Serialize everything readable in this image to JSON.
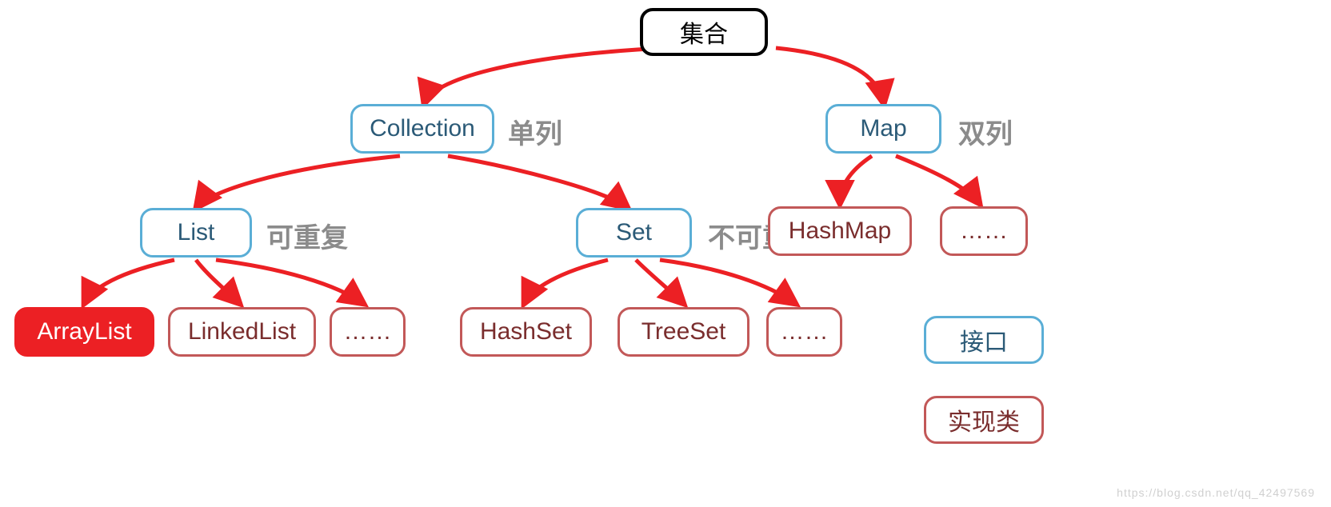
{
  "nodes": {
    "root": {
      "label": "集合"
    },
    "collection": {
      "label": "Collection"
    },
    "map": {
      "label": "Map"
    },
    "list": {
      "label": "List"
    },
    "set": {
      "label": "Set"
    },
    "arraylist": {
      "label": "ArrayList"
    },
    "linkedlist": {
      "label": "LinkedList"
    },
    "list_more": {
      "label": "……"
    },
    "hashset": {
      "label": "HashSet"
    },
    "treeset": {
      "label": "TreeSet"
    },
    "set_more": {
      "label": "……"
    },
    "hashmap": {
      "label": "HashMap"
    },
    "map_more": {
      "label": "……"
    }
  },
  "notes": {
    "collection_side": "单列",
    "map_side": "双列",
    "list_side": "可重复",
    "set_side": "不可重复"
  },
  "legend": {
    "interface": "接口",
    "implementation": "实现类"
  },
  "watermark": "https://blog.csdn.net/qq_42497569",
  "colors": {
    "arrow": "#ec2024",
    "interface_border": "#5aaed6",
    "impl_border": "#c25858",
    "highlight": "#ec2024"
  }
}
